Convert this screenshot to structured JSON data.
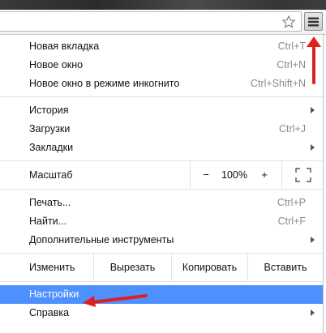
{
  "colors": {
    "highlight": "#4d90fe",
    "annotation_arrow": "#e02020",
    "shortcut_text": "#8a8a8a"
  },
  "toolbar": {
    "star_icon": "star-outline-icon",
    "menu_icon": "hamburger-menu-icon"
  },
  "menu": {
    "new_tab": {
      "label": "Новая вкладка",
      "shortcut": "Ctrl+T"
    },
    "new_window": {
      "label": "Новое окно",
      "shortcut": "Ctrl+N"
    },
    "incognito": {
      "label": "Новое окно в режиме инкогнито",
      "shortcut": "Ctrl+Shift+N"
    },
    "history": {
      "label": "История"
    },
    "downloads": {
      "label": "Загрузки",
      "shortcut": "Ctrl+J"
    },
    "bookmarks": {
      "label": "Закладки"
    },
    "zoom": {
      "label": "Масштаб",
      "minus": "−",
      "value": "100%",
      "plus": "+"
    },
    "print": {
      "label": "Печать...",
      "shortcut": "Ctrl+P"
    },
    "find": {
      "label": "Найти...",
      "shortcut": "Ctrl+F"
    },
    "more_tools": {
      "label": "Дополнительные инструменты"
    },
    "edit": {
      "label": "Изменить",
      "cut": "Вырезать",
      "copy": "Копировать",
      "paste": "Вставить"
    },
    "settings": {
      "label": "Настройки"
    },
    "help": {
      "label": "Справка"
    }
  }
}
